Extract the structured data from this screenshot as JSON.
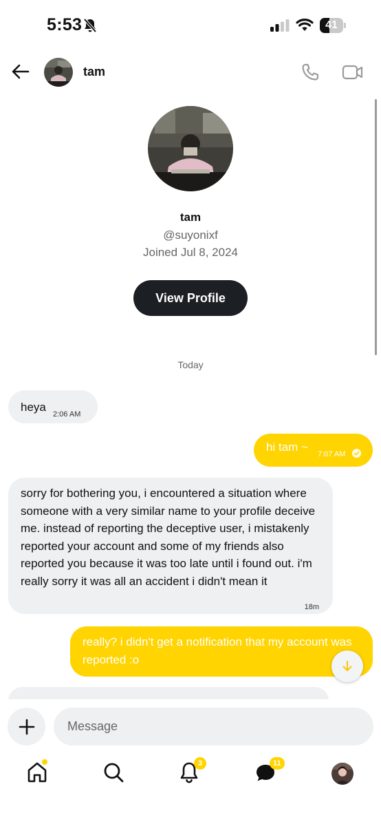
{
  "status_bar": {
    "time": "5:53",
    "battery_level": "41",
    "icons": [
      "bell-slash-icon",
      "cellular-signal-icon",
      "wifi-icon",
      "battery-icon"
    ]
  },
  "header": {
    "name": "tam",
    "icons": [
      "back-arrow-icon",
      "phone-icon",
      "video-camera-icon"
    ]
  },
  "profile": {
    "name": "tam",
    "handle": "@suyonixf",
    "joined": "Joined Jul 8, 2024",
    "view_profile_label": "View Profile"
  },
  "date_separator": "Today",
  "messages": [
    {
      "direction": "incoming",
      "text": "heya",
      "time": "2:06 AM"
    },
    {
      "direction": "outgoing",
      "text": "hi tam ~",
      "time": "7:07 AM",
      "read": true
    },
    {
      "direction": "incoming",
      "text": "sorry for bothering you, i encountered a situation where someone with a very similar name to your profile deceive me. instead of reporting the deceptive user, i mistakenly reported your account and some of my friends also reported you because it was too late until i found out. i'm really sorry it was all an accident i didn't mean it",
      "time": "18m"
    },
    {
      "direction": "outgoing",
      "text": "really? i didn't get a notification that my account was reported :o"
    }
  ],
  "composer": {
    "placeholder": "Message"
  },
  "bottom_nav": {
    "notifications_count": "3",
    "messages_count": "11"
  },
  "colors": {
    "accent": "#ffd400",
    "incoming_bubble": "#eef0f2",
    "dark_button": "#1c1f23"
  }
}
